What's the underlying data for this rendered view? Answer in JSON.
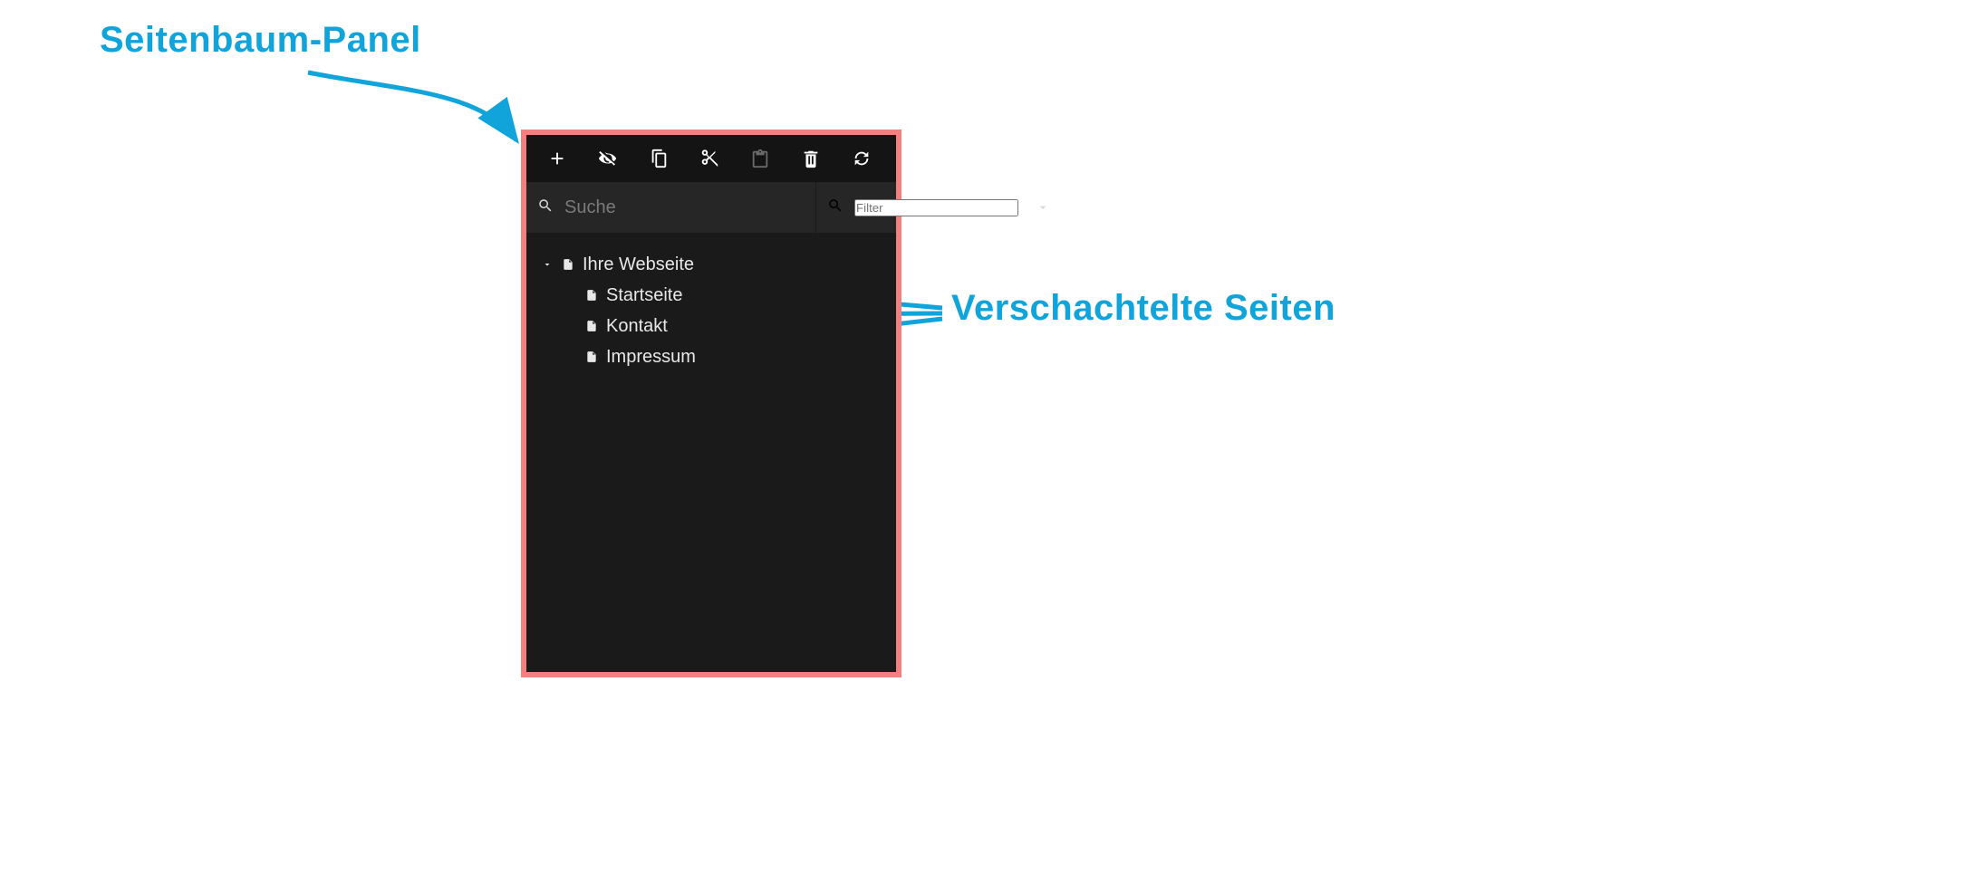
{
  "annotations": {
    "panel_label": "Seitenbaum-Panel",
    "nested_label": "Verschachtelte Seiten"
  },
  "colors": {
    "annotation": "#10a4db",
    "panel_border": "#f47f7f",
    "panel_bg": "#1a1a1a"
  },
  "toolbar": {
    "icons": {
      "add": "plus-icon",
      "hidden": "eye-slash-icon",
      "copy": "copy-icon",
      "cut": "cut-icon",
      "paste": "clipboard-icon",
      "delete": "trash-icon",
      "refresh": "refresh-icon"
    }
  },
  "search": {
    "placeholder": "Suche"
  },
  "filter": {
    "placeholder": "Filter"
  },
  "tree": {
    "root": {
      "label": "Ihre Webseite",
      "expanded": true
    },
    "children": [
      {
        "label": "Startseite"
      },
      {
        "label": "Kontakt"
      },
      {
        "label": "Impressum"
      }
    ]
  }
}
